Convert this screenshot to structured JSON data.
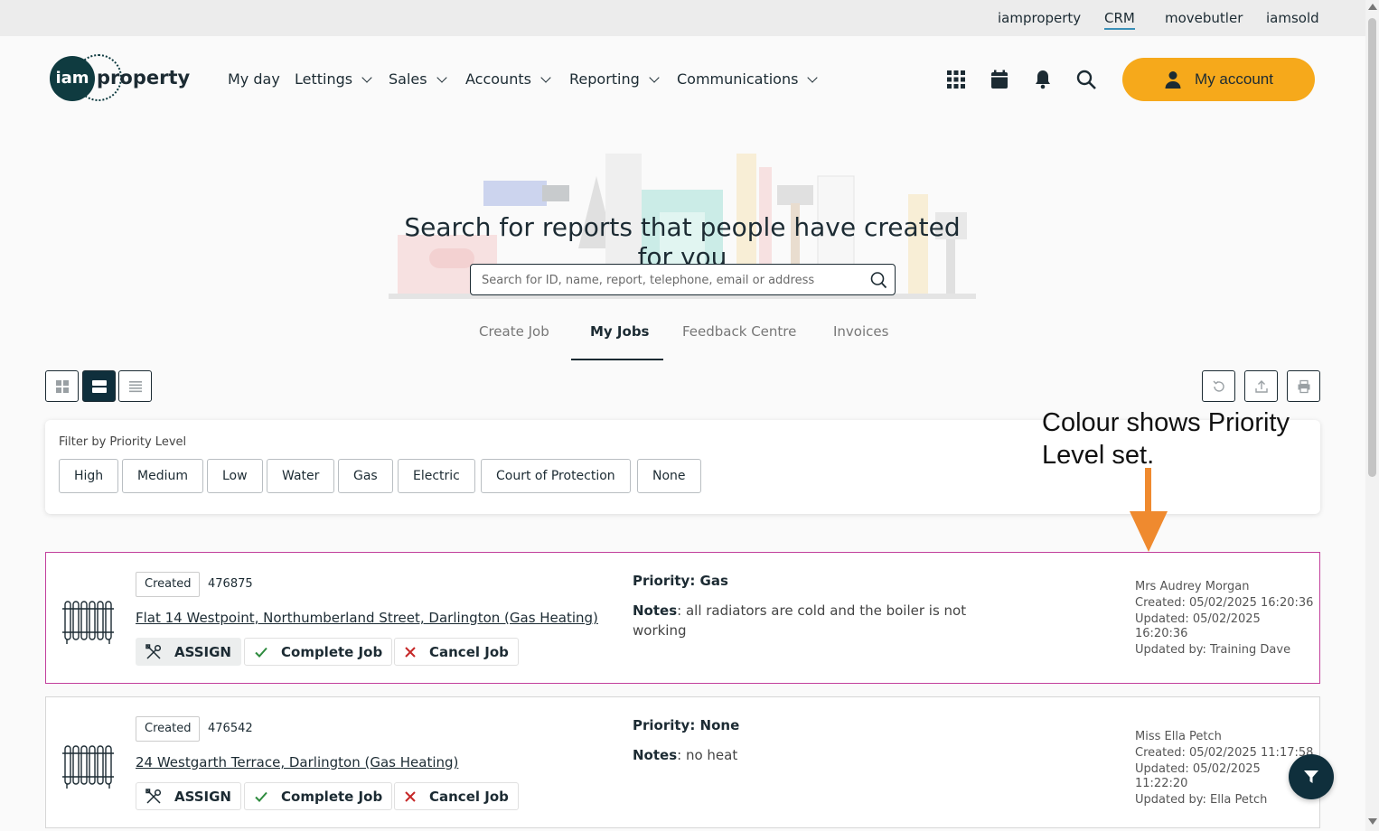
{
  "brandbar": {
    "links": [
      {
        "label": "iamproperty"
      },
      {
        "label": "CRM"
      },
      {
        "label": "movebutler"
      },
      {
        "label": "iamsold"
      }
    ]
  },
  "logo": {
    "mark": "iam",
    "word": "property"
  },
  "nav": {
    "items": [
      {
        "label": "My day"
      },
      {
        "label": "Lettings"
      },
      {
        "label": "Sales"
      },
      {
        "label": "Accounts"
      },
      {
        "label": "Reporting"
      },
      {
        "label": "Communications"
      }
    ],
    "icons": [
      "apps-grid-icon",
      "calendar-icon",
      "bell-icon",
      "search-icon"
    ],
    "account_label": "My account"
  },
  "hero": {
    "title": "Search for reports that people have created for you",
    "search_placeholder": "Search for ID, name, report, telephone, email or address"
  },
  "tabs": [
    {
      "label": "Create Job"
    },
    {
      "label": "My Jobs",
      "active": true
    },
    {
      "label": "Feedback Centre"
    },
    {
      "label": "Invoices"
    }
  ],
  "filter": {
    "label": "Filter by Priority Level",
    "chips": [
      "High",
      "Medium",
      "Low",
      "Water",
      "Gas",
      "Electric",
      "Court of Protection",
      "None"
    ]
  },
  "annotation": {
    "text": "Colour shows Priority Level set.",
    "arrow_color": "#ef8a2f"
  },
  "jobs": [
    {
      "status": "Created",
      "id": "476875",
      "address": "Flat 14 Westpoint, Northumberland Street, Darlington (Gas Heating)",
      "actions": {
        "assign": "ASSIGN",
        "complete": "Complete Job",
        "cancel": "Cancel Job"
      },
      "priority": "Priority: Gas",
      "notes_label": "Notes",
      "notes": ": all radiators are cold and the boiler is not working",
      "contact": "Mrs Audrey Morgan",
      "created": "Created: 05/02/2025 16:20:36",
      "updated": "Updated: 05/02/2025 16:20:36",
      "updated_by": "Updated by: Training Dave",
      "border_color": "#c2409c"
    },
    {
      "status": "Created",
      "id": "476542",
      "address": "24 Westgarth Terrace, Darlington (Gas Heating)",
      "actions": {
        "assign": "ASSIGN",
        "complete": "Complete Job",
        "cancel": "Cancel Job"
      },
      "priority": "Priority: None",
      "notes_label": "Notes",
      "notes": ": no heat",
      "contact": "Miss Ella Petch",
      "created": "Created: 05/02/2025 11:17:58",
      "updated": "Updated: 05/02/2025 11:22:20",
      "updated_by": "Updated by: Ella Petch",
      "border_color": "#d6d6d6"
    }
  ],
  "colors": {
    "accent": "#f6a91b",
    "dark": "#0f2f3c",
    "complete": "#2e8b3e",
    "cancel": "#c62828"
  }
}
